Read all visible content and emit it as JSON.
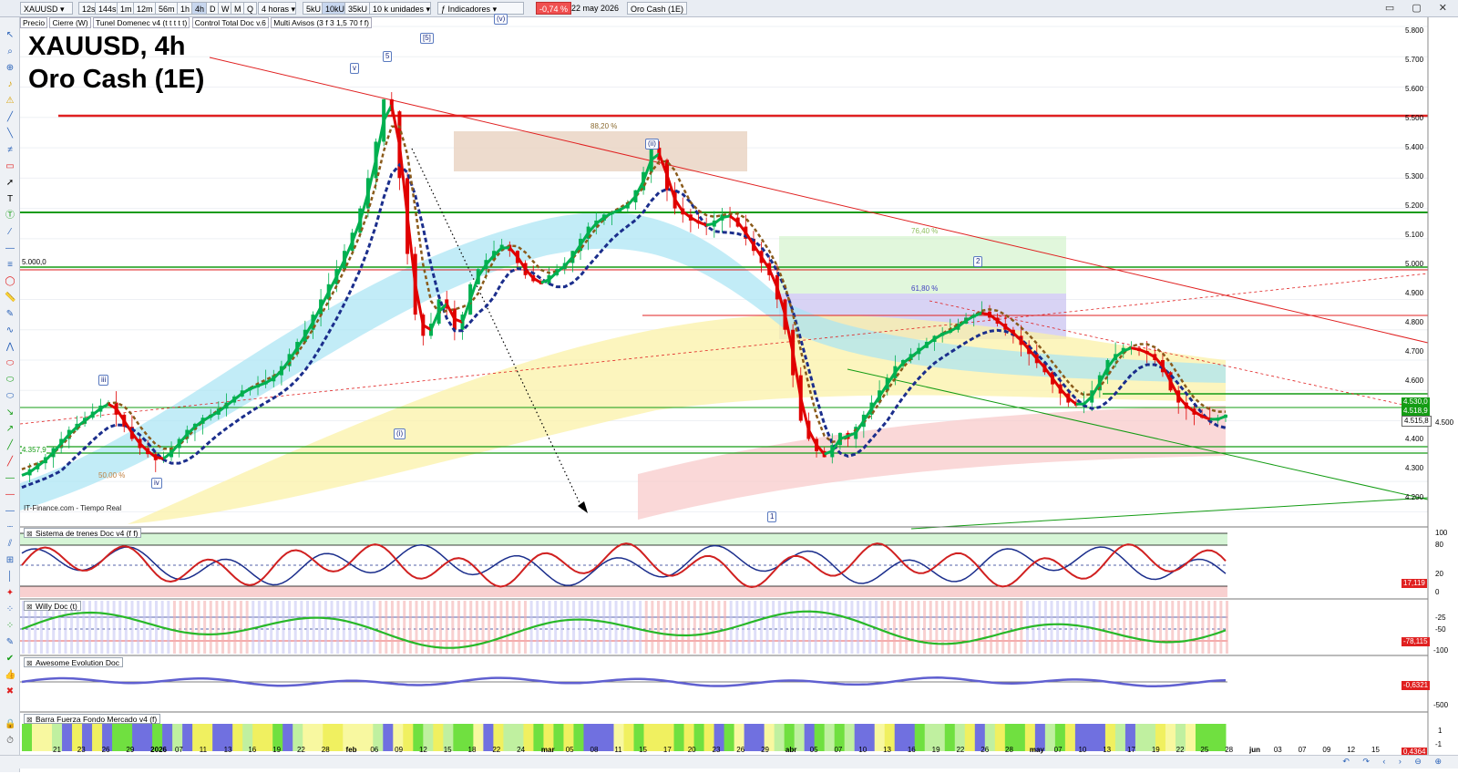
{
  "toolbar": {
    "symbol": "XAUUSD",
    "timeframes": [
      "12s",
      "144s",
      "1m",
      "12m",
      "56m",
      "1h",
      "4h",
      "D",
      "W",
      "M",
      "Q"
    ],
    "active_timeframe": "4h",
    "period": "4 horas",
    "units": [
      "5kU",
      "10kU",
      "35kU"
    ],
    "units_select": "10 k unidades",
    "indicators_button": "Indicadores",
    "change": "-0,74 %",
    "date": "22 may 2026",
    "instrument_name": "Oro Cash (1E)"
  },
  "overlays": [
    "Precio",
    "Cierre (W)",
    "Tunel Domenec v4 (t t t t t)",
    "Control Total Doc v.6",
    "Multi Avisos (3 f 3 1,5 70 f f)"
  ],
  "chart_title": {
    "line1": "XAUUSD, 4h",
    "line2": "Oro Cash (1E)"
  },
  "source_label": "IT-Finance.com - Tiempo Real",
  "price_axis": [
    "5.800",
    "5.700",
    "5.600",
    "5.500",
    "5.400",
    "5.300",
    "5.200",
    "5.100",
    "5.000",
    "4.900",
    "4.800",
    "4.700",
    "4.600",
    "4.500",
    "4.400",
    "4.300",
    "4.200"
  ],
  "price_boxes": [
    "4.530,0",
    "4.518,9",
    "4.515,8"
  ],
  "level_labels": [
    "5.000,0",
    "4.357,9"
  ],
  "fib_labels": [
    "88,20 %",
    "76,40 %",
    "61,80 %",
    "50,00 %"
  ],
  "wave_labels": [
    "v",
    "5",
    "[5]",
    "(v)",
    "(ii)",
    "2",
    "iii",
    "(i)",
    "iv",
    "1"
  ],
  "x_axis": [
    "21",
    "23",
    "26",
    "29",
    "2026",
    "07",
    "11",
    "13",
    "16",
    "19",
    "22",
    "28",
    "feb",
    "06",
    "09",
    "12",
    "15",
    "18",
    "22",
    "24",
    "mar",
    "05",
    "08",
    "11",
    "15",
    "17",
    "20",
    "23",
    "26",
    "29",
    "abr",
    "05",
    "07",
    "10",
    "13",
    "16",
    "19",
    "22",
    "26",
    "28",
    "may",
    "07",
    "10",
    "13",
    "17",
    "19",
    "22",
    "25",
    "28",
    "jun",
    "03",
    "07",
    "09",
    "12",
    "15"
  ],
  "panels": [
    {
      "title": "Sistema de trenes Doc v4 (f f)",
      "axis": [
        "100",
        "80",
        "20",
        "0"
      ],
      "value": "17,119"
    },
    {
      "title": "Willy Doc (t)",
      "axis": [
        "-25",
        "-50",
        "-100"
      ],
      "value": "-78,115"
    },
    {
      "title": "Awesome Evolution Doc",
      "axis": [
        "-500"
      ],
      "value": "-0,6321"
    },
    {
      "title": "Barra Fuerza Fondo Mercado v4 (f)",
      "axis": [
        "1",
        "-1"
      ],
      "value": "0,4364"
    }
  ],
  "colors": {
    "up": "#00b050",
    "down": "#e00000",
    "ma_blue": "#1b2e8c",
    "ma_brown": "#8a5a1a",
    "resistance": "#e02020",
    "support": "#149c14",
    "panel_bg_green": "#d6f5d6",
    "panel_bg_red": "#f8d0d0"
  },
  "chart_data": {
    "type": "candlestick",
    "y_range": [
      4150,
      5830
    ],
    "series": [
      {
        "values": [
          4320,
          4340,
          4360,
          4380,
          4410,
          4440,
          4470,
          4490,
          4510,
          4530,
          4550,
          4560,
          4520,
          4480,
          4440,
          4410,
          4390,
          4370,
          4380,
          4410,
          4440,
          4470,
          4490,
          4510,
          4520,
          4540,
          4560,
          4580,
          4600,
          4610,
          4620,
          4630,
          4650,
          4680,
          4720,
          4760,
          4800,
          4850,
          4900,
          4950,
          5000,
          5060,
          5120,
          5200,
          5300,
          5420,
          5560,
          5520,
          5300,
          5050,
          4850,
          4780,
          4820,
          4900,
          4870,
          4800,
          4850,
          4950,
          5000,
          5030,
          5060,
          5080,
          5060,
          5020,
          4980,
          4960,
          4950,
          4980,
          5000,
          5020,
          5060,
          5100,
          5140,
          5160,
          5180,
          5190,
          5200,
          5220,
          5260,
          5320,
          5400,
          5360,
          5260,
          5200,
          5180,
          5160,
          5150,
          5140,
          5160,
          5180,
          5170,
          5140,
          5100,
          5060,
          5020,
          4980,
          4900,
          4800,
          4650,
          4500,
          4440,
          4400,
          4380,
          4420,
          4460,
          4440,
          4480,
          4520,
          4560,
          4600,
          4640,
          4680,
          4700,
          4720,
          4740,
          4760,
          4780,
          4790,
          4800,
          4820,
          4840,
          4850,
          4860,
          4840,
          4820,
          4800,
          4780,
          4750,
          4720,
          4690,
          4660,
          4620,
          4590,
          4560,
          4550,
          4560,
          4600,
          4650,
          4700,
          4720,
          4740,
          4740,
          4730,
          4720,
          4700,
          4660,
          4600,
          4560,
          4540,
          4520,
          4510,
          4500,
          4510,
          4520
        ]
      }
    ]
  }
}
